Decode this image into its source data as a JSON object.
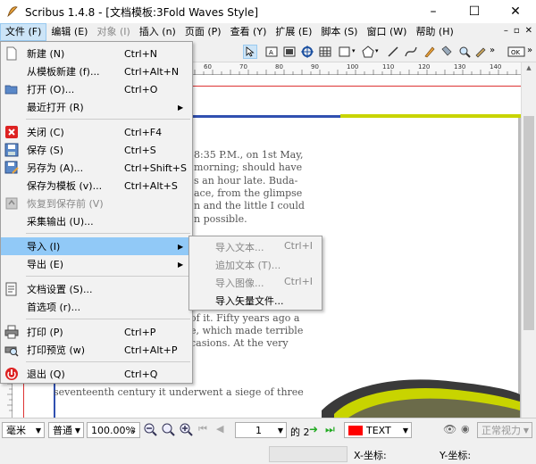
{
  "window": {
    "title": "Scribus 1.4.8 - [文档模板:3Fold Waves Style]",
    "minimize": "–",
    "maximize": "☐",
    "close": "✕"
  },
  "menubar": [
    {
      "label": "文件 (F)",
      "state": "active"
    },
    {
      "label": "编辑 (E)",
      "state": "normal"
    },
    {
      "label": "对象 (I)",
      "state": "disabled"
    },
    {
      "label": "插入 (n)",
      "state": "normal"
    },
    {
      "label": "页面 (P)",
      "state": "normal"
    },
    {
      "label": "查看 (Y)",
      "state": "normal"
    },
    {
      "label": "扩展 (E)",
      "state": "normal"
    },
    {
      "label": "脚本 (S)",
      "state": "normal"
    },
    {
      "label": "窗口 (W)",
      "state": "normal"
    },
    {
      "label": "帮助 (H)",
      "state": "normal"
    }
  ],
  "mdi_buttons": {
    "min": "–",
    "restore": "▫",
    "close": "✕"
  },
  "file_menu": {
    "items": [
      {
        "label": "新建 (N)",
        "shortcut": "Ctrl+N",
        "icon": "new-file-icon",
        "disabled": false
      },
      {
        "label": "从模板新建 (f)...",
        "shortcut": "Ctrl+Alt+N",
        "icon": "",
        "disabled": false
      },
      {
        "label": "打开 (O)...",
        "shortcut": "Ctrl+O",
        "icon": "open-folder-icon",
        "disabled": false
      },
      {
        "label": "最近打开 (R)",
        "shortcut": "",
        "icon": "",
        "disabled": false,
        "submenu": true
      },
      {
        "label": "关闭 (C)",
        "shortcut": "Ctrl+F4",
        "icon": "close-doc-icon",
        "disabled": false
      },
      {
        "label": "保存 (S)",
        "shortcut": "Ctrl+S",
        "icon": "save-icon",
        "disabled": false
      },
      {
        "label": "另存为 (A)...",
        "shortcut": "Ctrl+Shift+S",
        "icon": "save-as-icon",
        "disabled": false
      },
      {
        "label": "保存为模板 (v)...",
        "shortcut": "Ctrl+Alt+S",
        "icon": "",
        "disabled": false
      },
      {
        "label": "恢复到保存前 (V)",
        "shortcut": "",
        "icon": "revert-icon",
        "disabled": true
      },
      {
        "label": "采集输出 (U)...",
        "shortcut": "",
        "icon": "",
        "disabled": false
      },
      {
        "label": "导入 (I)",
        "shortcut": "",
        "icon": "",
        "disabled": false,
        "submenu": true,
        "highlight": true
      },
      {
        "label": "导出 (E)",
        "shortcut": "",
        "icon": "",
        "disabled": false,
        "submenu": true
      },
      {
        "label": "文档设置 (S)...",
        "shortcut": "",
        "icon": "doc-setup-icon",
        "disabled": false
      },
      {
        "label": "首选项 (r)...",
        "shortcut": "",
        "icon": "",
        "disabled": false
      },
      {
        "label": "打印 (P)",
        "shortcut": "Ctrl+P",
        "icon": "print-icon",
        "disabled": false
      },
      {
        "label": "打印预览 (w)",
        "shortcut": "Ctrl+Alt+P",
        "icon": "print-preview-icon",
        "disabled": false
      },
      {
        "label": "退出 (Q)",
        "shortcut": "Ctrl+Q",
        "icon": "quit-icon",
        "disabled": false
      }
    ]
  },
  "import_menu": {
    "items": [
      {
        "label": "导入文本...",
        "shortcut": "Ctrl+I",
        "disabled": true
      },
      {
        "label": "追加文本 (T)...",
        "shortcut": "",
        "disabled": true
      },
      {
        "label": "导入图像...",
        "shortcut": "Ctrl+I",
        "disabled": true
      },
      {
        "label": "导入矢量文件...",
        "shortcut": "",
        "disabled": false
      }
    ]
  },
  "document": {
    "lines": [
      "8:35 P.M., on 1st May,",
      "morning; should have",
      "s an hour late. Buda-",
      "ace, from the glimpse",
      "n and the little I could",
      "n possible.",
      "of it. Fifty years ago a",
      "e, which made terrible",
      "casions. At the very",
      "seventeenth century it underwent a siege of three"
    ]
  },
  "statusbar": {
    "unit": "毫米",
    "mode": "普通",
    "zoom": "100.00%",
    "page": "1",
    "page_of": "的 2",
    "layer": "TEXT",
    "view_mode": "正常视力",
    "x_label": "X-坐标:",
    "y_label": "Y-坐标:"
  },
  "colors": {
    "menu_highlight": "#91c9f7",
    "layer_swatch": "#ff0000",
    "accent_wave_yellow": "#c8d400",
    "accent_wave_dark": "#3a3a3a"
  }
}
